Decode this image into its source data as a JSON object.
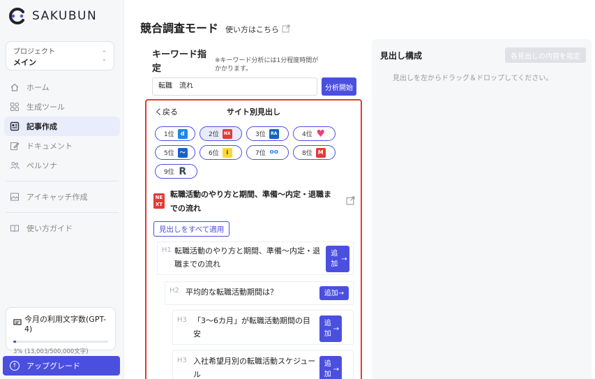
{
  "brand": {
    "name": "SAKUBUN"
  },
  "project": {
    "label": "プロジェクト",
    "value": "メイン"
  },
  "nav": {
    "items": [
      {
        "label": "ホーム",
        "icon": "home-icon"
      },
      {
        "label": "生成ツール",
        "icon": "grid-icon"
      },
      {
        "label": "記事作成",
        "icon": "article-icon",
        "active": true
      },
      {
        "label": "ドキュメント",
        "icon": "edit-icon"
      },
      {
        "label": "ペルソナ",
        "icon": "people-icon"
      },
      {
        "label": "アイキャッチ作成",
        "icon": "image-icon"
      },
      {
        "label": "使い方ガイド",
        "icon": "book-icon"
      }
    ]
  },
  "usage": {
    "title": "今月の利用文字数(GPT-4)",
    "text": "3% (13,003/500,000文字)",
    "percent": 3
  },
  "upgrade": {
    "label": "アップグレード"
  },
  "page": {
    "title": "競合調査モード",
    "help_link": "使い方はこちら"
  },
  "keyword": {
    "label": "キーワード指定",
    "note": "※キーワード分析には1分程度時間がかかります。",
    "value": "転職　流れ",
    "analyze_button": "分析開始"
  },
  "panel": {
    "back_label": "く戻る",
    "title": "サイト別見出し",
    "ranks": [
      {
        "label": "1位",
        "icon": "d",
        "color": "#1e88e5"
      },
      {
        "label": "2位",
        "icon": "NX",
        "color": "#e53935",
        "selected": true
      },
      {
        "label": "3位",
        "icon": "RA",
        "color": "#1565c0"
      },
      {
        "label": "4位",
        "icon": "♥",
        "color": "#ec407a"
      },
      {
        "label": "5位",
        "icon": "〜",
        "color": "#1565c0"
      },
      {
        "label": "6位",
        "icon": "i",
        "color": "#fdd835"
      },
      {
        "label": "7位",
        "icon": "oo",
        "color": "#1e88e5"
      },
      {
        "label": "8位",
        "icon": "M",
        "color": "#e53935"
      },
      {
        "label": "9位",
        "icon": "R",
        "color": "#37474f"
      }
    ],
    "site": {
      "logo_text": "NEXT",
      "title": "転職活動のやり方と期間、準備〜内定・退職までの流れ"
    },
    "apply_all_label": "見出しをすべて適用",
    "headings": [
      {
        "level": "H1",
        "text": "転職活動のやり方と期間、準備〜内定・退職までの流れ",
        "add_label": "追加"
      },
      {
        "level": "H2",
        "text": "平均的な転職活動期間は？",
        "add_label": "追加"
      },
      {
        "level": "H3",
        "text": "「3〜6カ月」が転職活動期間の目安",
        "add_label": "追加"
      },
      {
        "level": "H3",
        "text": "入社希望月別の転職活動スケジュール",
        "add_label": "追加"
      }
    ]
  },
  "outline": {
    "title": "見出し構成",
    "specify_button": "各見出しの内容を指定",
    "empty_text": "見出しを左からドラッグ＆ドロップしてください。"
  },
  "colors": {
    "accent": "#4b4fe0",
    "highlight_border": "#e53935"
  }
}
